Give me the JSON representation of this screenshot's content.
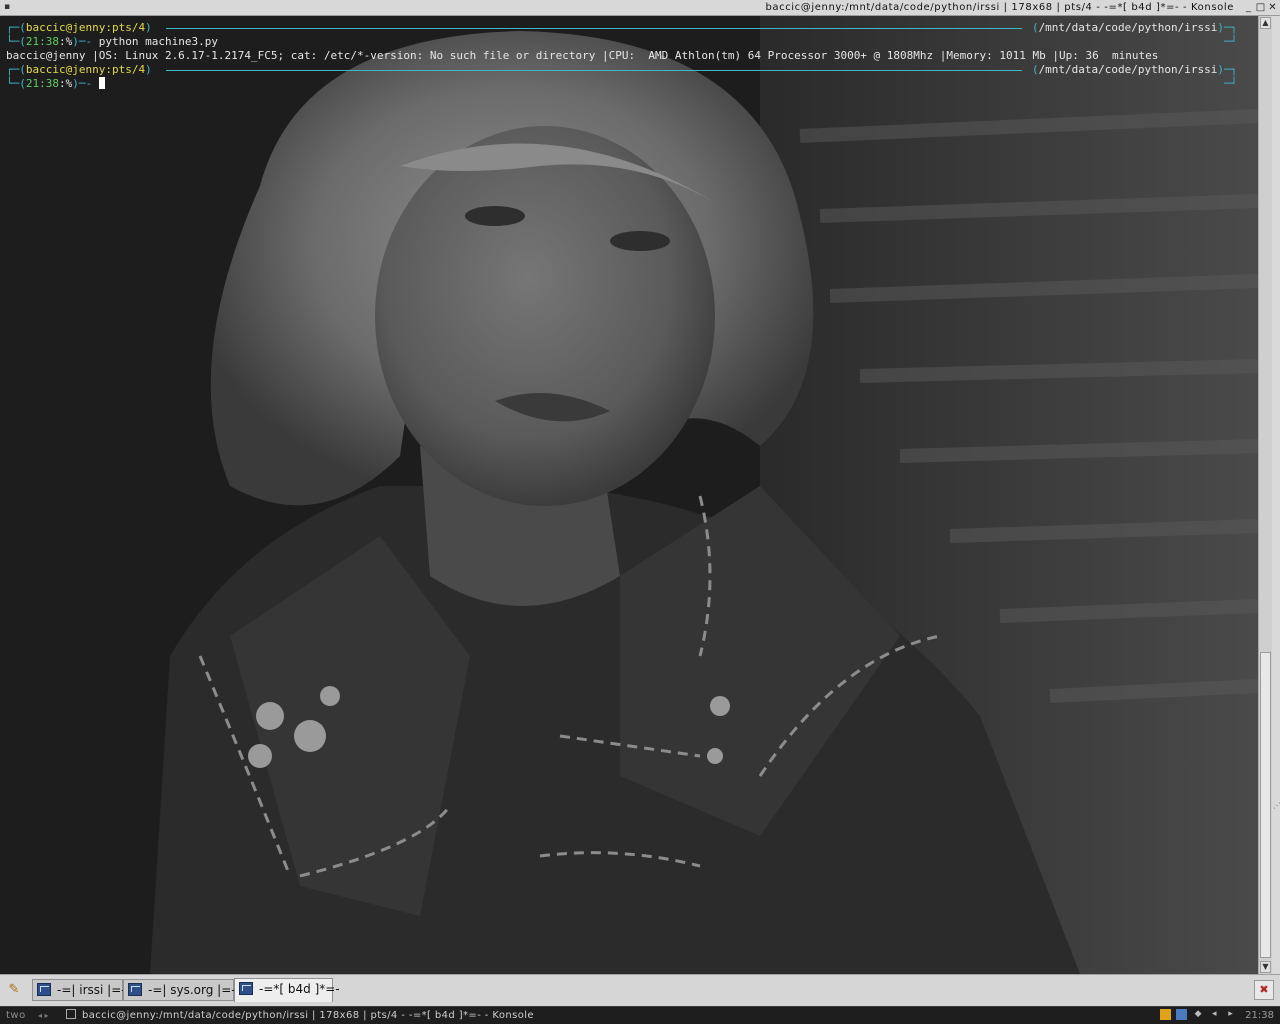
{
  "window": {
    "title": "baccic@jenny:/mnt/data/code/python/irssi | 178x68 | pts/4 - -=*[ b4d ]*=- - Konsole"
  },
  "terminal": {
    "prompt1": {
      "user_host": "baccic@jenny:pts/4",
      "path": "/mnt/data/code/python/irssi",
      "time": "21:38",
      "symbol": "%",
      "command": "python machine3.py"
    },
    "output_line": "baccic@jenny |OS: Linux 2.6.17-1.2174_FC5; cat: /etc/*-version: No such file or directory |CPU:  AMD Athlon(tm) 64 Processor 3000+ @ 1808Mhz |Memory: 1011 Mb |Up: 36  minutes",
    "prompt2": {
      "user_host": "baccic@jenny:pts/4",
      "path": "/mnt/data/code/python/irssi",
      "time": "21:38",
      "symbol": "%"
    },
    "wallpaper": "black-and-white portrait photograph of a blonde woman in a denim shirt"
  },
  "tabs": [
    {
      "label": "-=| irssi |=-",
      "active": false,
      "icon": "terminal-icon"
    },
    {
      "label": "-=| sys.org |=-",
      "active": false,
      "icon": "terminal-icon"
    },
    {
      "label": "-=*[ b4d ]*=-",
      "active": true,
      "icon": "terminal-icon"
    }
  ],
  "taskbar": {
    "desktop": "two",
    "task": "baccic@jenny:/mnt/data/code/python/irssi | 178x68 | pts/4 - -=*[ b4d ]*=- - Konsole",
    "clock": "21:38"
  },
  "colors": {
    "prompt_frame": "#3fb7c6",
    "prompt_host": "#e3d94a",
    "prompt_time": "#5fcf5f",
    "text": "#e6e6e6"
  }
}
